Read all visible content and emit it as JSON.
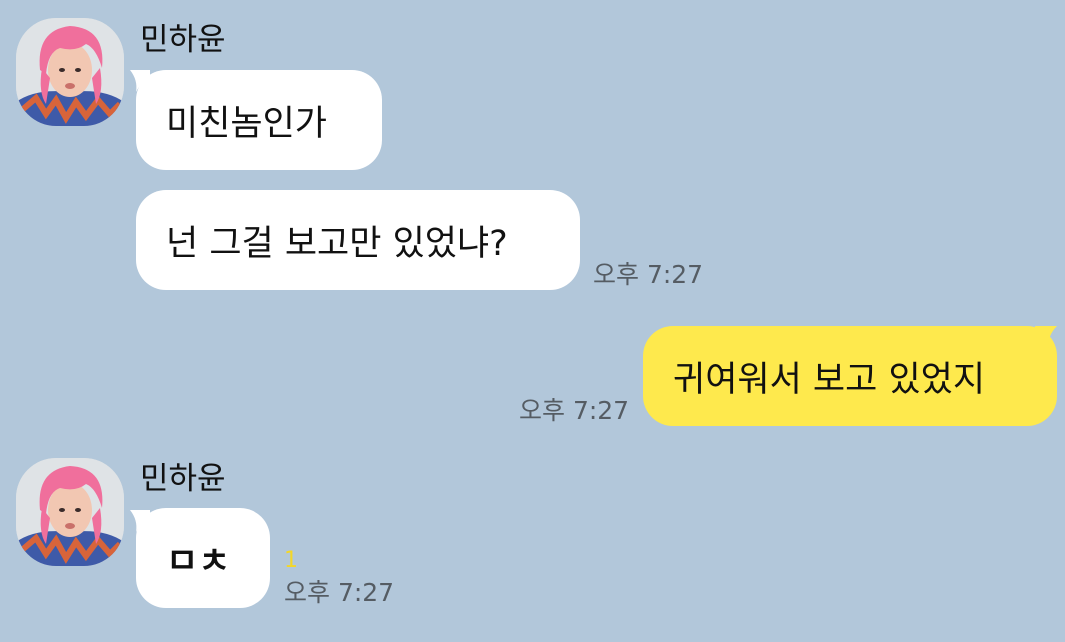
{
  "colors": {
    "background": "#b2c7da",
    "incoming_bubble": "#ffffff",
    "outgoing_bubble": "#fee94d",
    "unread": "#f4d728",
    "timestamp": "#555c63"
  },
  "messages": [
    {
      "group": "incoming",
      "sender": "민하윤",
      "avatar": "profile-photo",
      "lines": [
        "미친놈인가",
        "넌 그걸 보고만 있었냐?"
      ],
      "time": "오후 7:27"
    },
    {
      "group": "outgoing",
      "lines": [
        "귀여워서 보고 있었지"
      ],
      "time": "오후 7:27"
    },
    {
      "group": "incoming",
      "sender": "민하윤",
      "avatar": "profile-photo",
      "lines": [
        "ㅁㅊ"
      ],
      "unread": "1",
      "time": "오후 7:27"
    }
  ]
}
